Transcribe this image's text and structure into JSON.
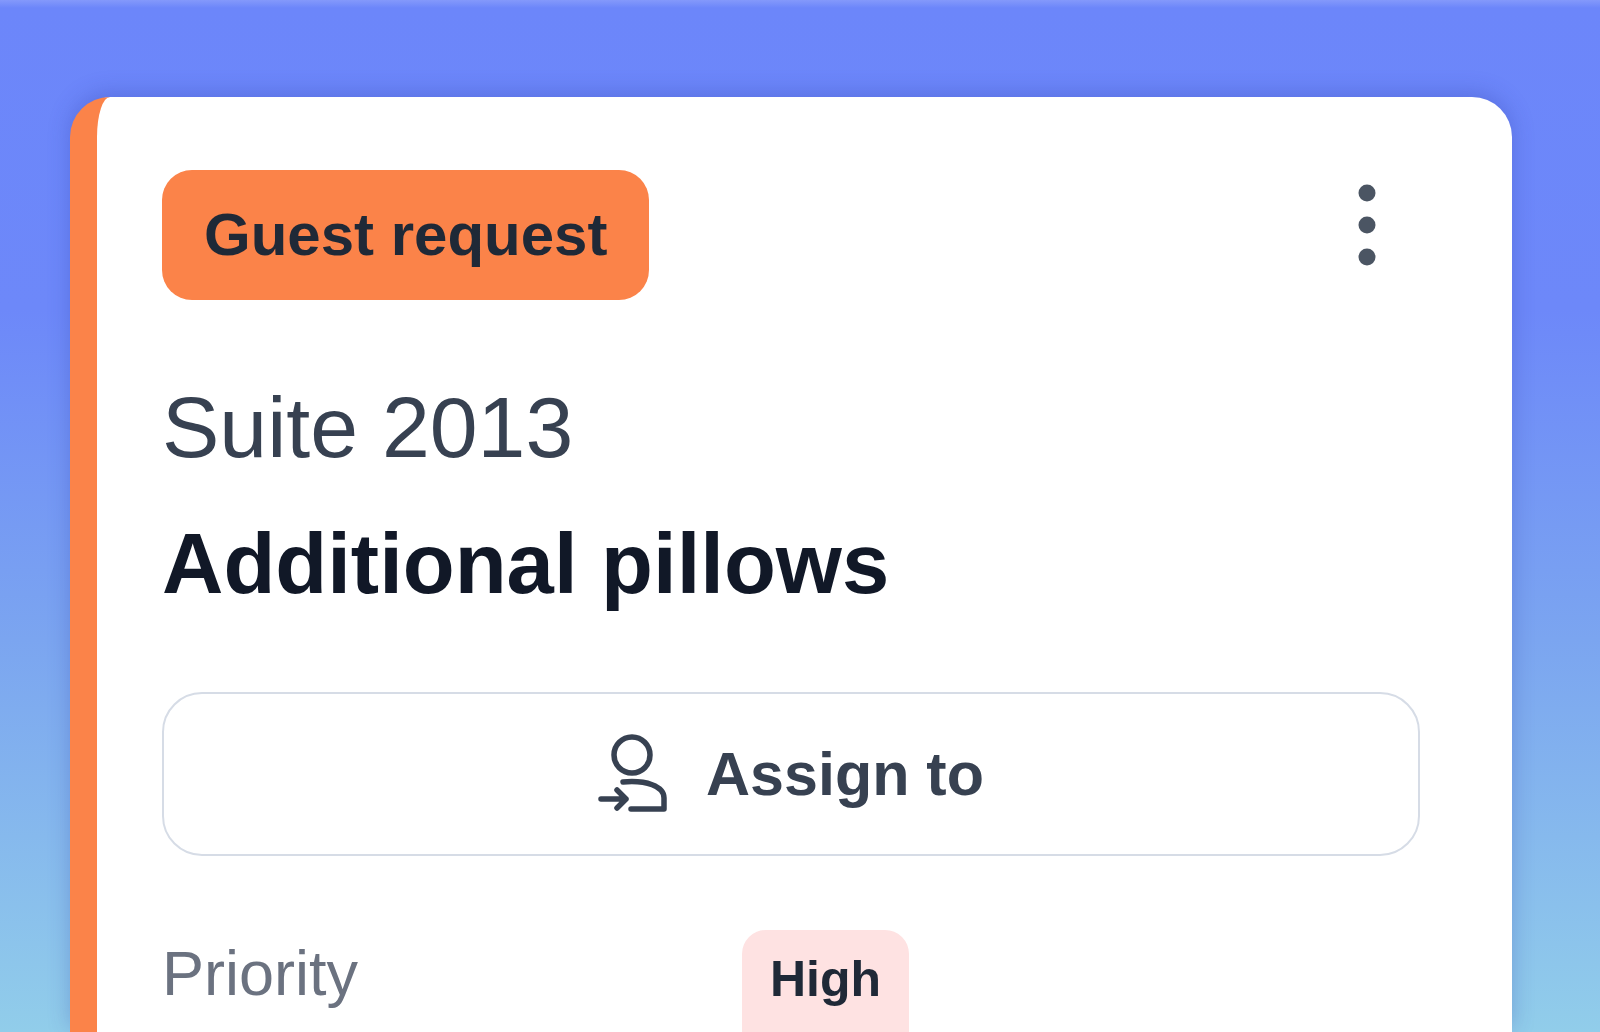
{
  "card": {
    "category": {
      "label": "Guest request",
      "color": "#fb8349"
    },
    "location": "Suite 2013",
    "title": "Additional pillows",
    "assign_button": {
      "label": "Assign to"
    },
    "priority": {
      "label": "Priority",
      "value": "High",
      "color": "#fee2e2"
    }
  }
}
